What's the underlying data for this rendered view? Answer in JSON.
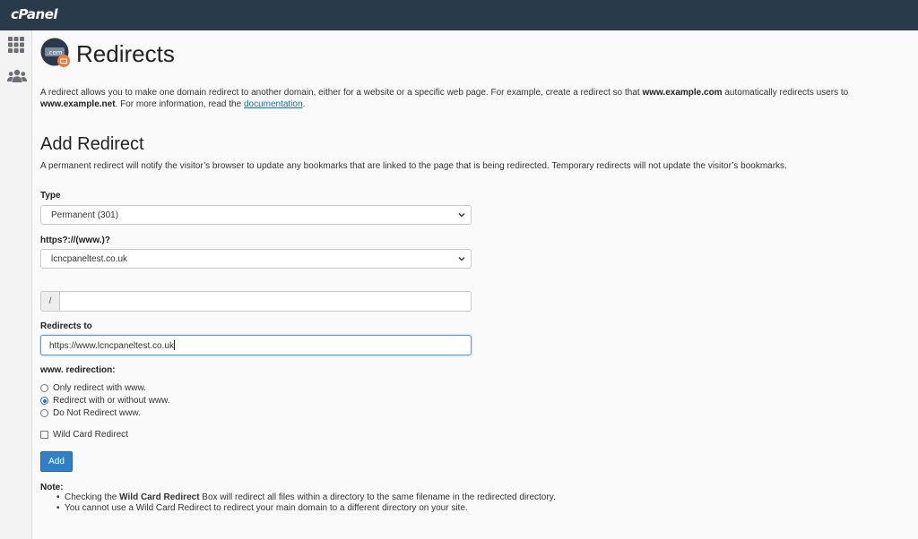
{
  "header": {
    "logo_text": "cPanel",
    "bg_color": "#293a4a"
  },
  "sidebar": {
    "items": [
      {
        "icon": "grid-icon"
      },
      {
        "icon": "users-icon"
      }
    ]
  },
  "page": {
    "title": "Redirects",
    "icon_text": ".com",
    "intro": {
      "part1": "A redirect allows you to make one domain redirect to another domain, either for a website or a specific web page. For example, create a redirect so that ",
      "bold1": "www.example.com",
      "part2": " automatically redirects users to ",
      "bold2": "www.example.net",
      "part3": ". For more information, read the ",
      "link": "documentation",
      "part4": "."
    }
  },
  "add_redirect": {
    "title": "Add Redirect",
    "description": "A permanent redirect will notify the visitor’s browser to update any bookmarks that are linked to the page that is being redirected. Temporary redirects will not update the visitor’s bookmarks.",
    "type_label": "Type",
    "type_value": "Permanent (301)",
    "domain_label": "https?://(www.)?",
    "domain_value": "lcncpaneltest.co.uk",
    "path_prefix": "/",
    "path_value": "",
    "redirects_to_label": "Redirects to",
    "redirects_to_value": "https://www.lcncpaneltest.co.uk",
    "www_label": "www. redirection:",
    "www_options": [
      {
        "label": "Only redirect with www.",
        "checked": false
      },
      {
        "label": "Redirect with or without www.",
        "checked": true
      },
      {
        "label": "Do Not Redirect www.",
        "checked": false
      }
    ],
    "wildcard_label": "Wild Card Redirect",
    "wildcard_checked": false,
    "add_button": "Add",
    "accent_color": "#2f7fca"
  },
  "note": {
    "label": "Note:",
    "item1_pre": "Checking the ",
    "item1_bold": "Wild Card Redirect",
    "item1_post": " Box will redirect all files within a directory to the same filename in the redirected directory.",
    "item2": "You cannot use a Wild Card Redirect to redirect your main domain to a different directory on your site."
  }
}
